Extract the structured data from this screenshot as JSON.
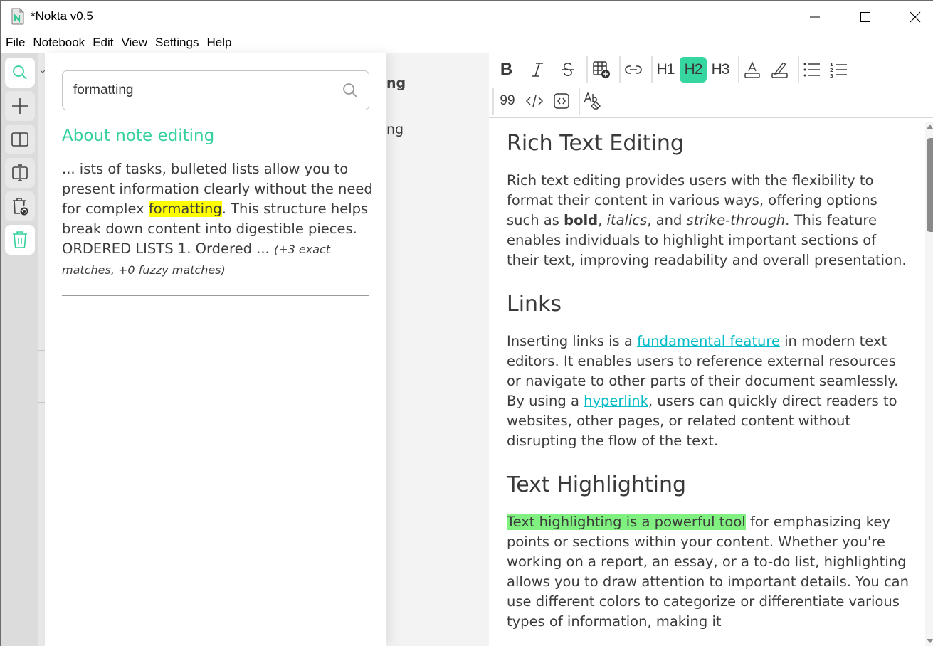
{
  "window": {
    "title": "*Nokta v0.5",
    "controls": [
      "minimize",
      "maximize",
      "close"
    ]
  },
  "menu": {
    "items": [
      "File",
      "Notebook",
      "Edit",
      "View",
      "Settings",
      "Help"
    ]
  },
  "rail": {
    "buttons": [
      {
        "name": "search",
        "icon": "search-icon",
        "active": true
      },
      {
        "name": "new-note",
        "icon": "plus-icon",
        "active": false
      },
      {
        "name": "notebooks",
        "icon": "book-open-icon",
        "active": false
      },
      {
        "name": "split-view",
        "icon": "split-view-icon",
        "active": false
      },
      {
        "name": "restore-trash",
        "icon": "trash-restore-icon",
        "active": false
      },
      {
        "name": "trash",
        "icon": "trash-icon",
        "active": true
      }
    ]
  },
  "notelist": {
    "fragments": [
      "ng",
      "ng"
    ]
  },
  "search": {
    "query": "formatting",
    "placeholder": "",
    "results": [
      {
        "title": "About note editing",
        "snippet_before": "... ists of tasks, bulleted lists allow you to present information clearly without the need for complex ",
        "snippet_match": "formatting",
        "snippet_after": ". This structure helps break down content into digestible pieces. ORDERED LISTS 1. Ordered ... ",
        "match_info": "(+3 exact matches, +0 fuzzy matches)"
      }
    ]
  },
  "toolbar": {
    "bold": "B",
    "h1": "H1",
    "h2": "H2",
    "h3": "H3",
    "quote": "99",
    "active_heading": "H2",
    "accent_color": "#35d6a0"
  },
  "document": {
    "sections": [
      {
        "heading": "Rich Text Editing",
        "p_1": "Rich text editing provides users with the flexibility to format their content in various ways, offering options such as ",
        "bold": "bold",
        "p_2": ", ",
        "italic": "italics",
        "p_3": ", and ",
        "strike_label": "strike-through",
        "p_4": ". This feature enables individuals to highlight important sections of their text, improving readability and overall presentation."
      },
      {
        "heading": "Links",
        "p_1": "Inserting links is a ",
        "link_1": "fundamental feature",
        "p_2": " in modern text editors. It enables users to reference external resources or navigate to other parts of their document seamlessly. By using a ",
        "link_2": "hyperlink",
        "p_3": ", users can quickly direct readers to websites, other pages, or related content without disrupting the flow of the text."
      },
      {
        "heading": "Text Highlighting",
        "highlight": "Text highlighting is a powerful tool",
        "p_1": " for emphasizing key points or sections within your content. Whether you're working on a report, an essay, or a to-do list, highlighting allows you to draw attention to important details. You can use different colors to categorize or differentiate various types of information, making it"
      }
    ]
  },
  "colors": {
    "accent": "#35d09f",
    "search_highlight": "#ffff00",
    "text_highlight": "#80f080",
    "link": "#00bcc6"
  }
}
